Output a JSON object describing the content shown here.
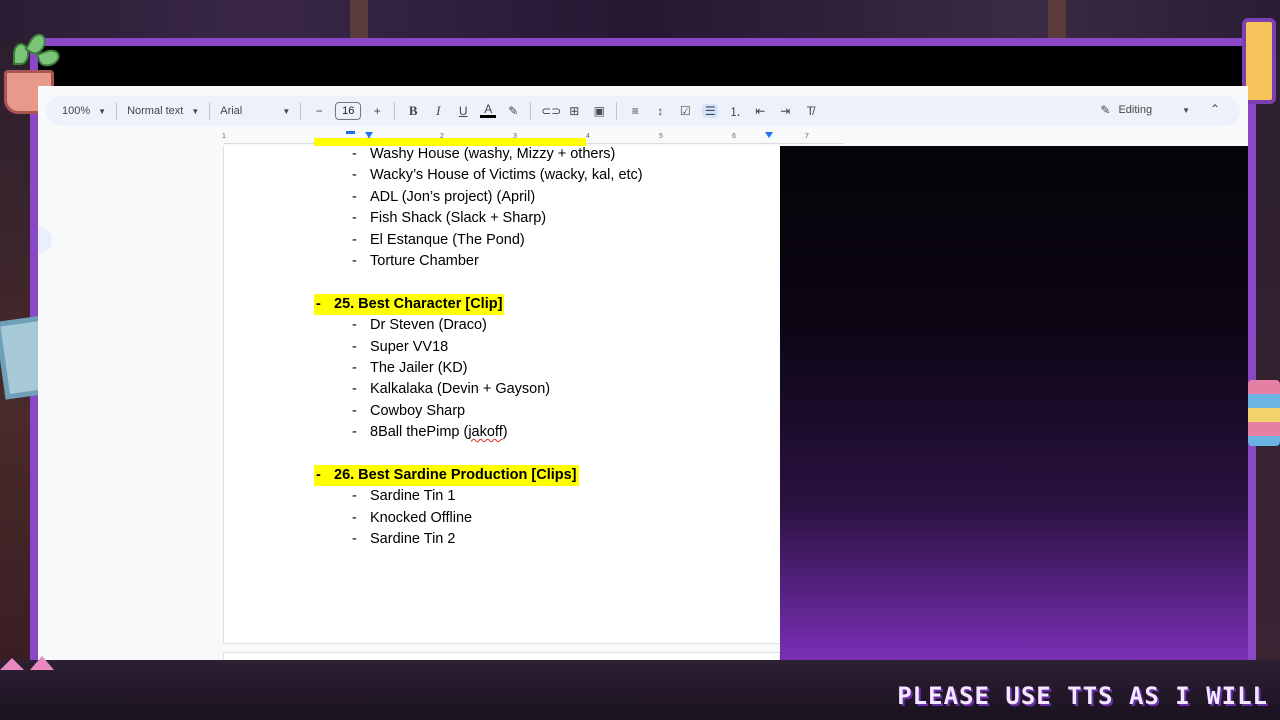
{
  "toolbar": {
    "zoom": "100%",
    "style": "Normal text",
    "font": "Arial",
    "font_size": "16",
    "mode": "Editing"
  },
  "ruler": {
    "ticks": [
      "1",
      "1",
      "2",
      "3",
      "4",
      "5",
      "6",
      "7"
    ]
  },
  "document": {
    "list_a": [
      "Washy House (washy, Mizzy + others)",
      "Wacky’s House of Victims (wacky, kal, etc)",
      "ADL (Jon’s project) (April)",
      "Fish Shack (Slack + Sharp)",
      "El Estanque (The Pond)",
      "Torture Chamber"
    ],
    "heading_25": "25. Best Character [Clip]",
    "list_b": [
      "Dr Steven (Draco)",
      "Super VV18",
      "The Jailer (KD)",
      "Kalkalaka (Devin + Gayson)",
      "Cowboy Sharp",
      "8Ball thePimp (jakoff)"
    ],
    "heading_26": "26. Best Sardine Production [Clips]",
    "list_c": [
      "Sardine Tin 1",
      "Knocked Offline",
      "Sardine Tin 2"
    ],
    "bullet": "-"
  },
  "overlay": {
    "ticker_text": "PLEASE USE TTS AS I WILL"
  },
  "colors": {
    "highlight": "#ffff00",
    "frame_accent": "#8a48c8"
  }
}
